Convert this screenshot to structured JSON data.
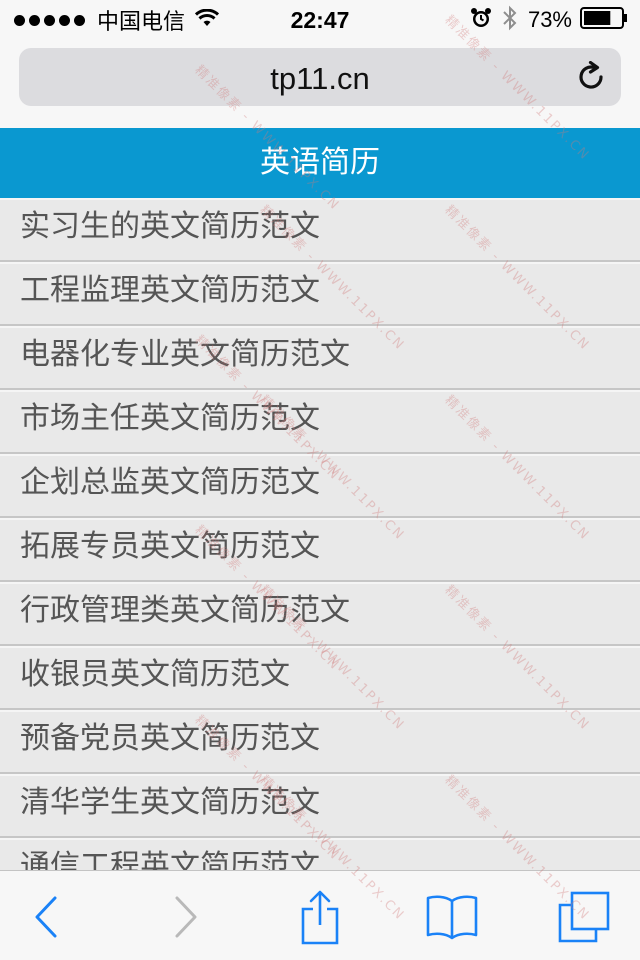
{
  "status_bar": {
    "carrier": "中国电信",
    "time": "22:47",
    "battery_percent": "73%",
    "battery_level": 0.73,
    "signal_bars": 5,
    "icons": [
      "wifi-icon",
      "alarm-icon",
      "bluetooth-icon",
      "battery-icon"
    ]
  },
  "browser": {
    "url": "tp11.cn",
    "reload_icon": "reload-icon"
  },
  "header": {
    "title": "英语简历",
    "color": "#0a98d0"
  },
  "list": {
    "items": [
      "实习生的英文简历范文",
      "工程监理英文简历范文",
      "电器化专业英文简历范文",
      "市场主任英文简历范文",
      "企划总监英文简历范文",
      "拓展专员英文简历范文",
      "行政管理类英文简历范文",
      "收银员英文简历范文",
      "预备党员英文简历范文",
      "清华学生英文简历范文",
      "通信工程英文简历范文"
    ]
  },
  "toolbar": {
    "icons": [
      "back-icon",
      "forward-icon",
      "share-icon",
      "bookmarks-icon",
      "tabs-icon"
    ],
    "accent": "#1a82f7"
  },
  "watermark": {
    "text": "精准像素 - WWW.11PX.CN"
  }
}
